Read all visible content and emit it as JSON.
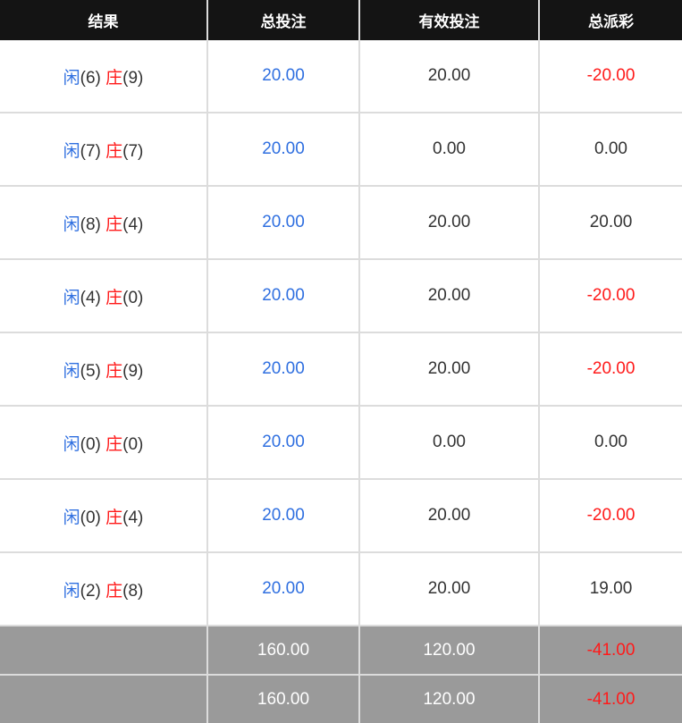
{
  "headers": [
    "结果",
    "总投注",
    "有效投注",
    "总派彩"
  ],
  "labels": {
    "player": "闲",
    "banker": "庄"
  },
  "rows": [
    {
      "player": "(6)",
      "banker": "(9)",
      "total_bet": "20.00",
      "valid_bet": "20.00",
      "payout": "-20.00",
      "payout_negative": true
    },
    {
      "player": "(7)",
      "banker": "(7)",
      "total_bet": "20.00",
      "valid_bet": "0.00",
      "payout": "0.00",
      "payout_negative": false
    },
    {
      "player": "(8)",
      "banker": "(4)",
      "total_bet": "20.00",
      "valid_bet": "20.00",
      "payout": "20.00",
      "payout_negative": false
    },
    {
      "player": "(4)",
      "banker": "(0)",
      "total_bet": "20.00",
      "valid_bet": "20.00",
      "payout": "-20.00",
      "payout_negative": true
    },
    {
      "player": "(5)",
      "banker": "(9)",
      "total_bet": "20.00",
      "valid_bet": "20.00",
      "payout": "-20.00",
      "payout_negative": true
    },
    {
      "player": "(0)",
      "banker": "(0)",
      "total_bet": "20.00",
      "valid_bet": "0.00",
      "payout": "0.00",
      "payout_negative": false
    },
    {
      "player": "(0)",
      "banker": "(4)",
      "total_bet": "20.00",
      "valid_bet": "20.00",
      "payout": "-20.00",
      "payout_negative": true
    },
    {
      "player": "(2)",
      "banker": "(8)",
      "total_bet": "20.00",
      "valid_bet": "20.00",
      "payout": "19.00",
      "payout_negative": false
    }
  ],
  "totals": [
    {
      "label": "",
      "total_bet": "160.00",
      "valid_bet": "120.00",
      "payout": "-41.00"
    },
    {
      "label": "",
      "total_bet": "160.00",
      "valid_bet": "120.00",
      "payout": "-41.00"
    }
  ],
  "colors": {
    "player": "#2f6fe0",
    "banker": "#ff1a1a",
    "header_bg": "#141414",
    "total_bg": "#9a9a9a",
    "negative": "#ff1a1a"
  }
}
